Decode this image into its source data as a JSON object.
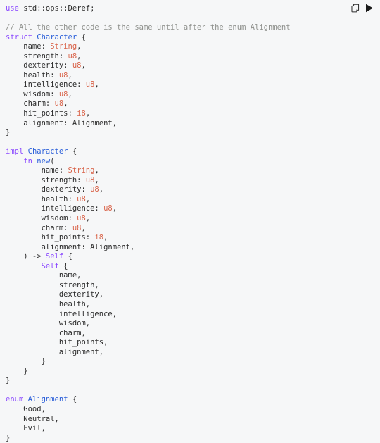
{
  "block": {
    "language": "rust",
    "background_color": "#f6f7f8",
    "colors": {
      "keyword": "#8c4bff",
      "type_name": "#2b5fd9",
      "primitive_type": "#d9644a",
      "comment": "#8e908c",
      "plain_text": "#2b2b2b"
    }
  },
  "toolbar": {
    "copy_label": "Copy to clipboard",
    "copy_icon": "copy-icon",
    "run_label": "Run",
    "run_icon": "play-icon"
  },
  "code": {
    "lines": [
      [
        {
          "t": "use",
          "c": "kw"
        },
        {
          "t": " std::ops::Deref;",
          "c": "plain"
        }
      ],
      [],
      [
        {
          "t": "// All the other code is the same until after the enum Alignment",
          "c": "comment"
        }
      ],
      [
        {
          "t": "struct",
          "c": "kw"
        },
        {
          "t": " ",
          "c": "plain"
        },
        {
          "t": "Character",
          "c": "type"
        },
        {
          "t": " {",
          "c": "plain"
        }
      ],
      [
        {
          "t": "    name: ",
          "c": "plain"
        },
        {
          "t": "String",
          "c": "prim"
        },
        {
          "t": ",",
          "c": "plain"
        }
      ],
      [
        {
          "t": "    strength: ",
          "c": "plain"
        },
        {
          "t": "u8",
          "c": "prim"
        },
        {
          "t": ",",
          "c": "plain"
        }
      ],
      [
        {
          "t": "    dexterity: ",
          "c": "plain"
        },
        {
          "t": "u8",
          "c": "prim"
        },
        {
          "t": ",",
          "c": "plain"
        }
      ],
      [
        {
          "t": "    health: ",
          "c": "plain"
        },
        {
          "t": "u8",
          "c": "prim"
        },
        {
          "t": ",",
          "c": "plain"
        }
      ],
      [
        {
          "t": "    intelligence: ",
          "c": "plain"
        },
        {
          "t": "u8",
          "c": "prim"
        },
        {
          "t": ",",
          "c": "plain"
        }
      ],
      [
        {
          "t": "    wisdom: ",
          "c": "plain"
        },
        {
          "t": "u8",
          "c": "prim"
        },
        {
          "t": ",",
          "c": "plain"
        }
      ],
      [
        {
          "t": "    charm: ",
          "c": "plain"
        },
        {
          "t": "u8",
          "c": "prim"
        },
        {
          "t": ",",
          "c": "plain"
        }
      ],
      [
        {
          "t": "    hit_points: ",
          "c": "plain"
        },
        {
          "t": "i8",
          "c": "prim"
        },
        {
          "t": ",",
          "c": "plain"
        }
      ],
      [
        {
          "t": "    alignment: Alignment,",
          "c": "plain"
        }
      ],
      [
        {
          "t": "}",
          "c": "plain"
        }
      ],
      [],
      [
        {
          "t": "impl",
          "c": "kw"
        },
        {
          "t": " ",
          "c": "plain"
        },
        {
          "t": "Character",
          "c": "type"
        },
        {
          "t": " {",
          "c": "plain"
        }
      ],
      [
        {
          "t": "    ",
          "c": "plain"
        },
        {
          "t": "fn",
          "c": "kw"
        },
        {
          "t": " ",
          "c": "plain"
        },
        {
          "t": "new",
          "c": "type"
        },
        {
          "t": "(",
          "c": "plain"
        }
      ],
      [
        {
          "t": "        name: ",
          "c": "plain"
        },
        {
          "t": "String",
          "c": "prim"
        },
        {
          "t": ",",
          "c": "plain"
        }
      ],
      [
        {
          "t": "        strength: ",
          "c": "plain"
        },
        {
          "t": "u8",
          "c": "prim"
        },
        {
          "t": ",",
          "c": "plain"
        }
      ],
      [
        {
          "t": "        dexterity: ",
          "c": "plain"
        },
        {
          "t": "u8",
          "c": "prim"
        },
        {
          "t": ",",
          "c": "plain"
        }
      ],
      [
        {
          "t": "        health: ",
          "c": "plain"
        },
        {
          "t": "u8",
          "c": "prim"
        },
        {
          "t": ",",
          "c": "plain"
        }
      ],
      [
        {
          "t": "        intelligence: ",
          "c": "plain"
        },
        {
          "t": "u8",
          "c": "prim"
        },
        {
          "t": ",",
          "c": "plain"
        }
      ],
      [
        {
          "t": "        wisdom: ",
          "c": "plain"
        },
        {
          "t": "u8",
          "c": "prim"
        },
        {
          "t": ",",
          "c": "plain"
        }
      ],
      [
        {
          "t": "        charm: ",
          "c": "plain"
        },
        {
          "t": "u8",
          "c": "prim"
        },
        {
          "t": ",",
          "c": "plain"
        }
      ],
      [
        {
          "t": "        hit_points: ",
          "c": "plain"
        },
        {
          "t": "i8",
          "c": "prim"
        },
        {
          "t": ",",
          "c": "plain"
        }
      ],
      [
        {
          "t": "        alignment: Alignment,",
          "c": "plain"
        }
      ],
      [
        {
          "t": "    ) -> ",
          "c": "plain"
        },
        {
          "t": "Self",
          "c": "kw"
        },
        {
          "t": " {",
          "c": "plain"
        }
      ],
      [
        {
          "t": "        ",
          "c": "plain"
        },
        {
          "t": "Self",
          "c": "kw"
        },
        {
          "t": " {",
          "c": "plain"
        }
      ],
      [
        {
          "t": "            name,",
          "c": "plain"
        }
      ],
      [
        {
          "t": "            strength,",
          "c": "plain"
        }
      ],
      [
        {
          "t": "            dexterity,",
          "c": "plain"
        }
      ],
      [
        {
          "t": "            health,",
          "c": "plain"
        }
      ],
      [
        {
          "t": "            intelligence,",
          "c": "plain"
        }
      ],
      [
        {
          "t": "            wisdom,",
          "c": "plain"
        }
      ],
      [
        {
          "t": "            charm,",
          "c": "plain"
        }
      ],
      [
        {
          "t": "            hit_points,",
          "c": "plain"
        }
      ],
      [
        {
          "t": "            alignment,",
          "c": "plain"
        }
      ],
      [
        {
          "t": "        }",
          "c": "plain"
        }
      ],
      [
        {
          "t": "    }",
          "c": "plain"
        }
      ],
      [
        {
          "t": "}",
          "c": "plain"
        }
      ],
      [],
      [
        {
          "t": "enum",
          "c": "kw"
        },
        {
          "t": " ",
          "c": "plain"
        },
        {
          "t": "Alignment",
          "c": "type"
        },
        {
          "t": " {",
          "c": "plain"
        }
      ],
      [
        {
          "t": "    Good,",
          "c": "plain"
        }
      ],
      [
        {
          "t": "    Neutral,",
          "c": "plain"
        }
      ],
      [
        {
          "t": "    Evil,",
          "c": "plain"
        }
      ],
      [
        {
          "t": "}",
          "c": "plain"
        }
      ]
    ]
  }
}
